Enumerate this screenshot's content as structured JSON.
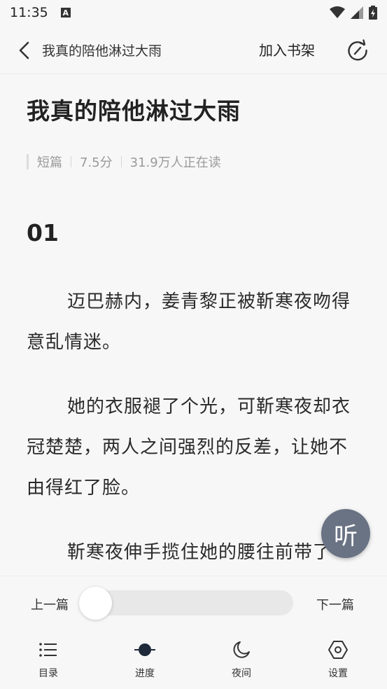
{
  "status": {
    "time": "11:35",
    "notification_icon": "A"
  },
  "nav": {
    "title": "我真的陪他淋过大雨",
    "shelf_button": "加入书架"
  },
  "book": {
    "title": "我真的陪他淋过大雨",
    "meta": {
      "category": "短篇",
      "rating": "7.5分",
      "readers": "31.9万人正在读"
    }
  },
  "chapter": {
    "heading": "01",
    "paragraphs": [
      "迈巴赫内，姜青黎正被靳寒夜吻得意乱情迷。",
      "她的衣服褪了个光，可靳寒夜却衣冠楚楚，两人之间强烈的反差，让她不由得红了脸。",
      "靳寒夜伸手揽住她的腰往前带了"
    ]
  },
  "listen_button": "听",
  "pager": {
    "prev": "上一篇",
    "next": "下一篇",
    "progress": 0.0
  },
  "tabs": [
    {
      "label": "目录",
      "icon": "list-icon"
    },
    {
      "label": "进度",
      "icon": "progress-icon"
    },
    {
      "label": "夜间",
      "icon": "moon-icon"
    },
    {
      "label": "设置",
      "icon": "settings-icon"
    }
  ]
}
